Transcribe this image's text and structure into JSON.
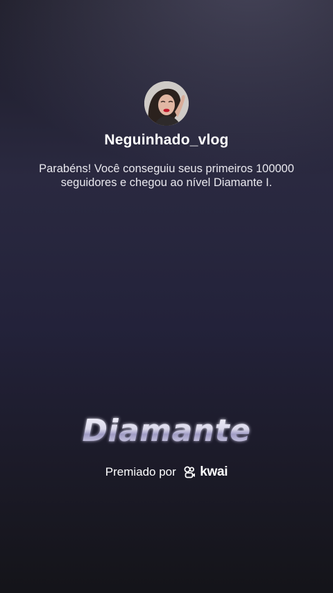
{
  "profile": {
    "username": "Neguinhado_vlog",
    "avatar_icon": "profile-photo"
  },
  "message": {
    "text": "Parabéns! Você conseguiu seus primeiros 100000 seguidores e chegou ao nível Diamante I."
  },
  "level": {
    "name": "Diamante"
  },
  "award": {
    "prefix": "Premiado por",
    "brand_name": "kwai",
    "brand_icon": "kwai-logo-icon"
  },
  "colors": {
    "background_top": "#2a2940",
    "background_bottom": "#141419",
    "text_primary": "#ffffff",
    "level_gradient_light": "#f2f1fa",
    "level_gradient_dark": "#8b87b4"
  }
}
